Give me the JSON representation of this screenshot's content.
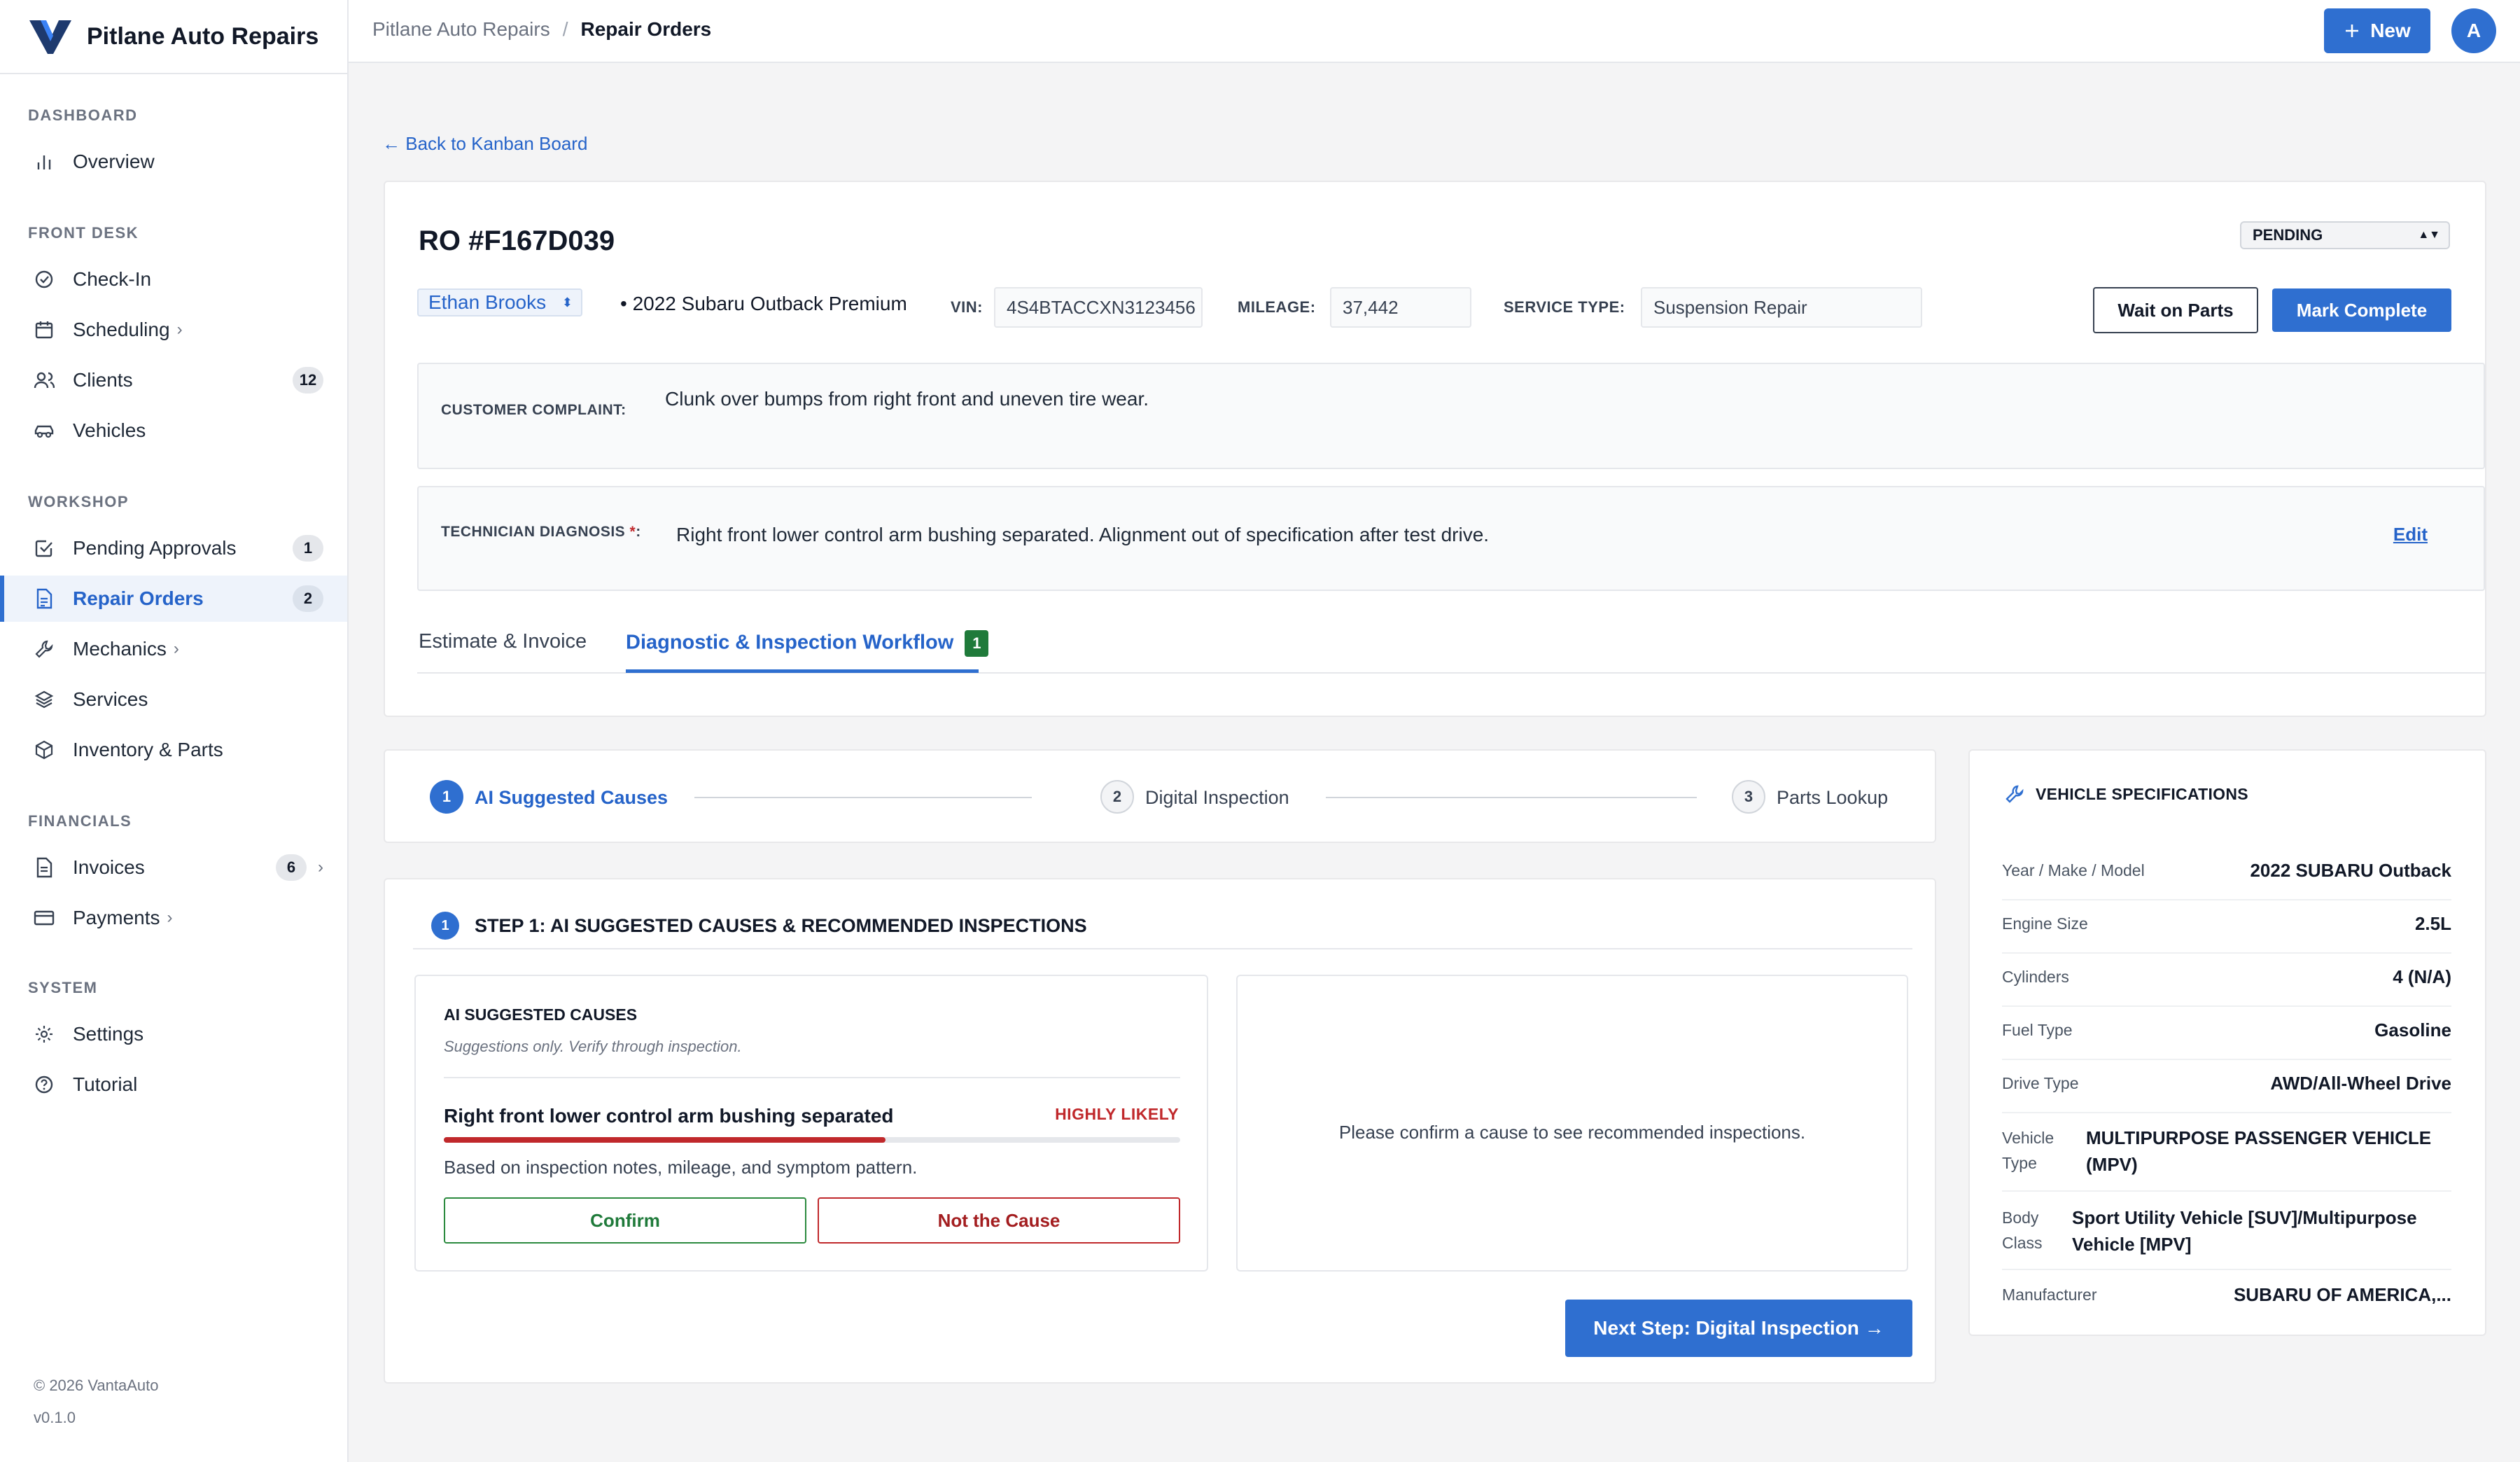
{
  "app": {
    "name": "Pitlane Auto Repairs"
  },
  "sidebar": {
    "sections": {
      "dashboard": "DASHBOARD",
      "front_desk": "FRONT DESK",
      "workshop": "WORKSHOP",
      "financials": "FINANCIALS",
      "system": "SYSTEM"
    },
    "items": {
      "overview": "Overview",
      "checkin": "Check-In",
      "scheduling": "Scheduling",
      "clients": "Clients",
      "clients_badge": "12",
      "vehicles": "Vehicles",
      "pending": "Pending Approvals",
      "pending_badge": "1",
      "repair_orders": "Repair Orders",
      "repair_orders_badge": "2",
      "mechanics": "Mechanics",
      "services": "Services",
      "inventory": "Inventory & Parts",
      "invoices": "Invoices",
      "invoices_badge": "6",
      "payments": "Payments",
      "settings": "Settings",
      "tutorial": "Tutorial"
    },
    "footer": {
      "copyright": "© 2026 VantaAuto",
      "version": "v0.1.0"
    }
  },
  "topbar": {
    "breadcrumb": {
      "root": "Pitlane Auto Repairs",
      "sep": "/",
      "current": "Repair Orders"
    },
    "new_label": "New",
    "avatar_initial": "A"
  },
  "back_link": "← Back to Kanban Board",
  "ro": {
    "title": "RO #F167D039",
    "status": "PENDING",
    "customer": "Ethan Brooks",
    "vehicle": "• 2022 Subaru Outback Premium",
    "vin_label": "VIN:",
    "vin": "4S4BTACCXN3123456",
    "mileage_label": "MILEAGE:",
    "mileage": "37,442",
    "service_type_label": "SERVICE TYPE:",
    "service_type": "Suspension Repair",
    "wait_label": "Wait on Parts",
    "complete_label": "Mark Complete",
    "complaint_label": "CUSTOMER COMPLAINT:",
    "complaint": "Clunk over bumps from right front and uneven tire wear.",
    "diagnosis_label": "TECHNICIAN DIAGNOSIS",
    "diagnosis_req": "*",
    "diagnosis_colon": ":",
    "diagnosis": "Right front lower control arm bushing separated. Alignment out of specification after test drive.",
    "edit_label": "Edit",
    "tabs": {
      "estimate": "Estimate & Invoice",
      "diagnostic": "Diagnostic & Inspection Workflow",
      "diagnostic_badge": "1"
    }
  },
  "stepper": {
    "s1_num": "1",
    "s1_label": "AI Suggested Causes",
    "s2_num": "2",
    "s2_label": "Digital Inspection",
    "s3_num": "3",
    "s3_label": "Parts Lookup"
  },
  "step1": {
    "num": "1",
    "heading": "STEP 1: AI SUGGESTED CAUSES & RECOMMENDED INSPECTIONS",
    "ai_title": "AI SUGGESTED CAUSES",
    "ai_sub": "Suggestions only. Verify through inspection.",
    "cause": "Right front lower control arm bushing separated",
    "likelihood": "HIGHLY LIKELY",
    "likelihood_fraction": 0.6,
    "basis": "Based on inspection notes, mileage, and symptom pattern.",
    "confirm_label": "Confirm",
    "not_cause_label": "Not the Cause",
    "empty_msg": "Please confirm a cause to see recommended inspections.",
    "next_label": "Next Step: Digital Inspection →"
  },
  "specs": {
    "title": "VEHICLE SPECIFICATIONS",
    "ymm_k": "Year / Make / Model",
    "ymm_v": "2022 SUBARU Outback",
    "engine_k": "Engine Size",
    "engine_v": "2.5L",
    "cyl_k": "Cylinders",
    "cyl_v": "4 (N/A)",
    "fuel_k": "Fuel Type",
    "fuel_v": "Gasoline",
    "drive_k": "Drive Type",
    "drive_v": "AWD/All-Wheel Drive",
    "vtype_k1": "Vehicle",
    "vtype_k2": "Type",
    "vtype_v1": "MULTIPURPOSE PASSENGER VEHICLE",
    "vtype_v2": "(MPV)",
    "body_k1": "Body",
    "body_k2": "Class",
    "body_v1": "Sport Utility Vehicle [SUV]/Multipurpose",
    "body_v2": "Vehicle [MPV]",
    "mfr_k": "Manufacturer",
    "mfr_v": "SUBARU OF AMERICA,..."
  },
  "colors": {
    "primary": "#2f6fd0",
    "danger": "#c0282b",
    "success": "#1f7a3a"
  }
}
